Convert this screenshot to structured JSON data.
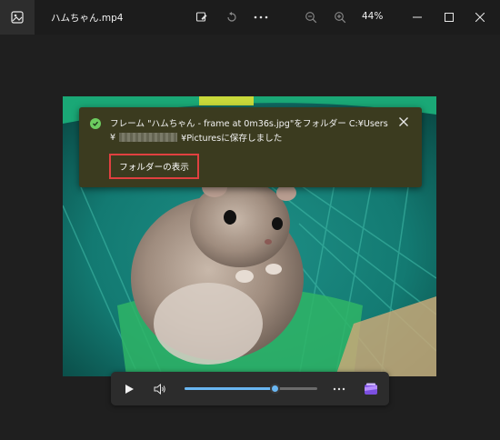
{
  "window": {
    "title": "ハムちゃん.mp4",
    "zoom": "44%"
  },
  "titlebar_icons": [
    "edit-image-icon",
    "rotate-icon",
    "more-icon",
    "zoom-out-icon",
    "zoom-in-icon",
    "minimize-icon",
    "maximize-icon",
    "close-icon"
  ],
  "toast": {
    "line1": "フレーム \"ハムちゃん - frame at 0m36s.jpg\"をフォルダー C:¥Users",
    "line2_prefix": "¥",
    "line2_suffix": "¥Picturesに保存しました",
    "button_label": "フォルダーの表示"
  },
  "player": {
    "progress": 0.68,
    "accent_color": "#69b6f1"
  },
  "colors": {
    "toast_bg": "#3b3b1f",
    "highlight_border": "#e04040",
    "success": "#6ccb5f"
  }
}
